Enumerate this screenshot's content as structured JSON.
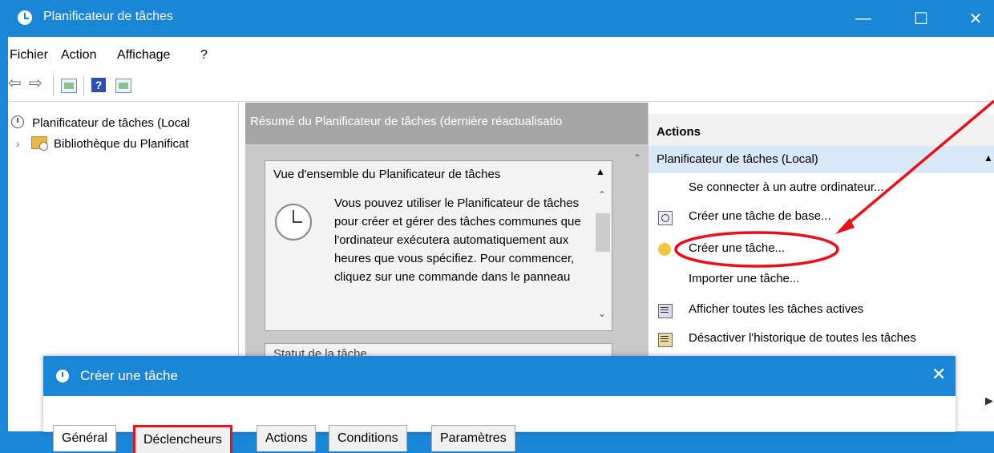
{
  "window": {
    "title": "Planificateur de tâches",
    "minimize": "—",
    "maximize": "☐",
    "close": "✕"
  },
  "menu": [
    "Fichier",
    "Action",
    "Affichage",
    "?"
  ],
  "toolbar": {
    "back": "⇦",
    "forward": "⇨",
    "help": "?"
  },
  "tree": {
    "root": "Planificateur de tâches (Local",
    "child": "Bibliothèque du Planificat",
    "expander": "›"
  },
  "middle": {
    "header": "Résumé du Planificateur de tâches (dernière réactualisatio",
    "overview_title": "Vue d'ensemble du Planificateur de tâches",
    "overview_caret": "▲",
    "overview_text": "Vous pouvez utiliser le Planificateur de tâches pour créer et gérer des tâches communes que l'ordinateur exécutera automatiquement aux heures que vous spécifiez. Pour commencer, cliquez sur une commande dans le panneau",
    "status_title": "Statut de la tâche",
    "scroll_up": "⌃",
    "scroll_down": "⌄"
  },
  "actions": {
    "header": "Actions",
    "group": "Planificateur de tâches (Local)",
    "group_arrow": "▲",
    "items": [
      "Se connecter à un autre ordinateur...",
      "Créer une tâche de base...",
      "Créer une tâche...",
      "Importer une tâche...",
      "Afficher toutes les tâches actives",
      "Désactiver l'historique de toutes les tâches"
    ],
    "side_arrow": "▶"
  },
  "dialog": {
    "title": "Créer une tâche",
    "close": "✕",
    "tabs": [
      "Général",
      "Déclencheurs",
      "Actions",
      "Conditions",
      "Paramètres"
    ]
  },
  "colors": {
    "titlebar": "#1a86d6",
    "annotation": "#e8101a",
    "selected_group": "#d9e8f7"
  }
}
